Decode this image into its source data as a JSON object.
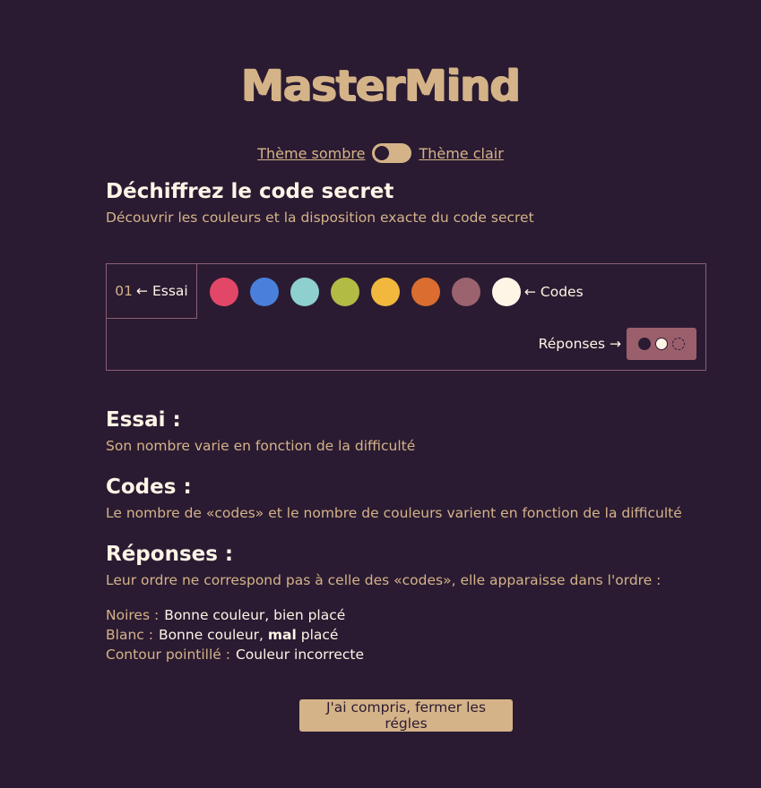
{
  "app": {
    "logo_text": "MasterMind"
  },
  "theme": {
    "dark_label": "Thème sombre",
    "light_label": "Thème clair",
    "selected": "dark"
  },
  "intro": {
    "title": "Déchiffrez le code secret",
    "subtitle": "Découvrir les couleurs et la disposition exacte du code secret"
  },
  "demo": {
    "essai_number": "01",
    "essai_label": "← Essai",
    "codes_label": "← Codes",
    "responses_label": "Réponses →",
    "code_colors": [
      "#e24768",
      "#4a7fdb",
      "#8ecfcf",
      "#b2bb43",
      "#f1b83d",
      "#da6d2f",
      "#9a636e",
      "#fff5e6"
    ],
    "response_pegs": [
      "black",
      "white",
      "dotted"
    ]
  },
  "sections": {
    "essai": {
      "title": "Essai :",
      "text": "Son nombre varie en fonction de la difficulté"
    },
    "codes": {
      "title": "Codes :",
      "text": "Le nombre de «codes» et le nombre de couleurs varient en fonction de la difficulté"
    },
    "reponses": {
      "title": "Réponses :",
      "text": "Leur ordre ne correspond pas à celle des «codes», elle apparaisse dans l'ordre :"
    }
  },
  "legend": {
    "black_key": "Noires :",
    "black_value": "Bonne couleur, bien placé",
    "white_key": "Blanc :",
    "white_value_before": "Bonne couleur, ",
    "white_value_bold": "mal",
    "white_value_after": " placé",
    "dotted_key": "Contour pointillé :",
    "dotted_value": "Couleur incorrecte"
  },
  "button": {
    "close_label": "J'ai compris, fermer les régles"
  },
  "colors": {
    "background": "#2a1b32",
    "accent": "#d5b388",
    "text_light": "#fff5e6",
    "peg_box": "#9b5f6c"
  }
}
